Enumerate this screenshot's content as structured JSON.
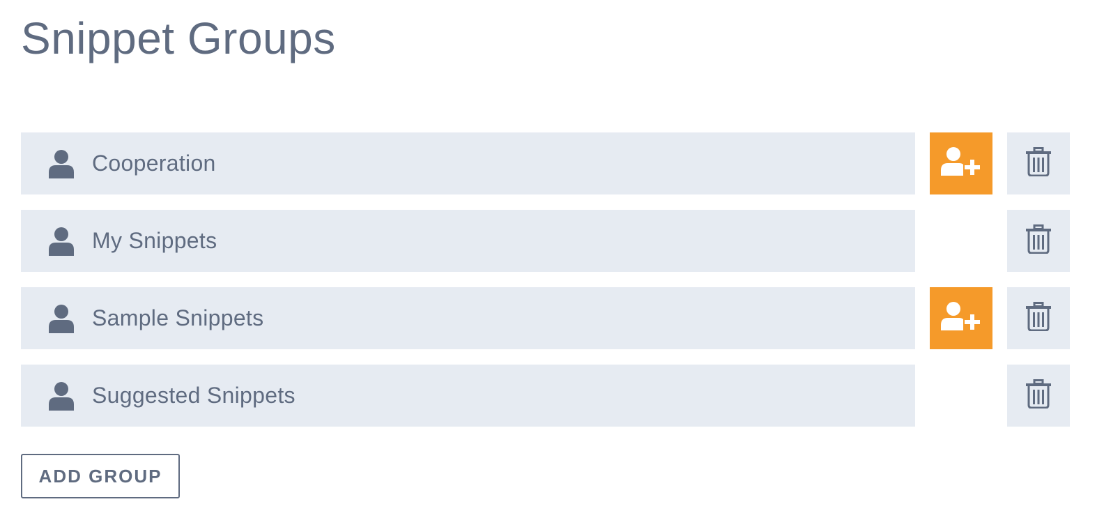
{
  "page": {
    "title": "Snippet Groups"
  },
  "groups": [
    {
      "label": "Cooperation",
      "shareable": true,
      "person_icon": "person-icon",
      "share_icon": "add-user-icon",
      "delete_icon": "trash-icon"
    },
    {
      "label": "My Snippets",
      "shareable": false,
      "person_icon": "person-icon",
      "delete_icon": "trash-icon"
    },
    {
      "label": "Sample Snippets",
      "shareable": true,
      "person_icon": "person-icon",
      "share_icon": "add-user-icon",
      "delete_icon": "trash-icon"
    },
    {
      "label": "Suggested Snippets",
      "shareable": false,
      "person_icon": "person-icon",
      "delete_icon": "trash-icon"
    }
  ],
  "actions": {
    "add_group_label": "ADD GROUP"
  },
  "colors": {
    "text": "#5f6b80",
    "row_background": "#e6ebf2",
    "accent": "#f59a2a",
    "background": "#ffffff"
  }
}
